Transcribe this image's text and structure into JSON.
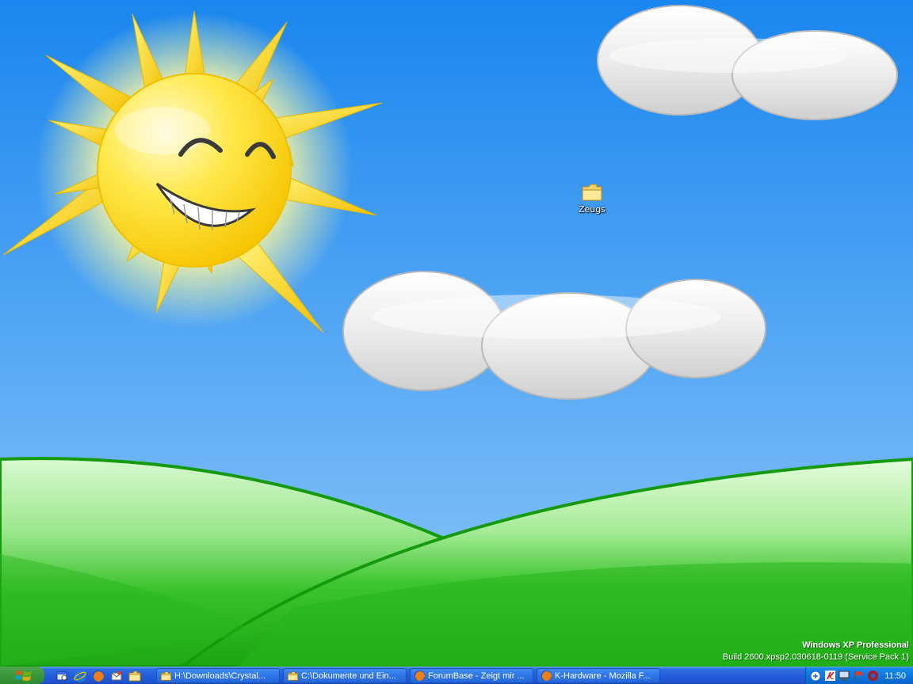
{
  "desktop": {
    "icons": [
      {
        "label": "Zeugs",
        "icon": "folder-icon"
      }
    ],
    "watermark": {
      "edition": "Windows XP Professional",
      "build": "Build 2600.xpsp2.030618-0119 (Service Pack 1)"
    }
  },
  "taskbar": {
    "start": {
      "icon": "windows-logo-icon"
    },
    "quicklaunch": [
      {
        "icon": "show-desktop-icon"
      },
      {
        "icon": "internet-explorer-icon"
      },
      {
        "icon": "firefox-icon"
      },
      {
        "icon": "email-icon"
      },
      {
        "icon": "folder-icon"
      }
    ],
    "tasks": [
      {
        "label": "H:\\Downloads\\Crystal...",
        "icon": "folder-icon"
      },
      {
        "label": "C:\\Dokumente und Ein...",
        "icon": "folder-icon"
      },
      {
        "label": "ForumBase - Zeigt mir ...",
        "icon": "firefox-icon"
      },
      {
        "label": "K-Hardware - Mozilla F...",
        "icon": "firefox-icon"
      }
    ],
    "tray": {
      "icons": [
        "network-icon",
        "antivirus-icon",
        "monitor-icon",
        "flag-icon",
        "shield-icon"
      ],
      "clock": "11:50"
    }
  },
  "colors": {
    "sky_top": "#1e8af0",
    "sky_bottom": "#86c3f8",
    "grass": "#22b51c",
    "taskbar": "#245ddb",
    "start": "#3c9a3c",
    "tray": "#0c78e0"
  }
}
